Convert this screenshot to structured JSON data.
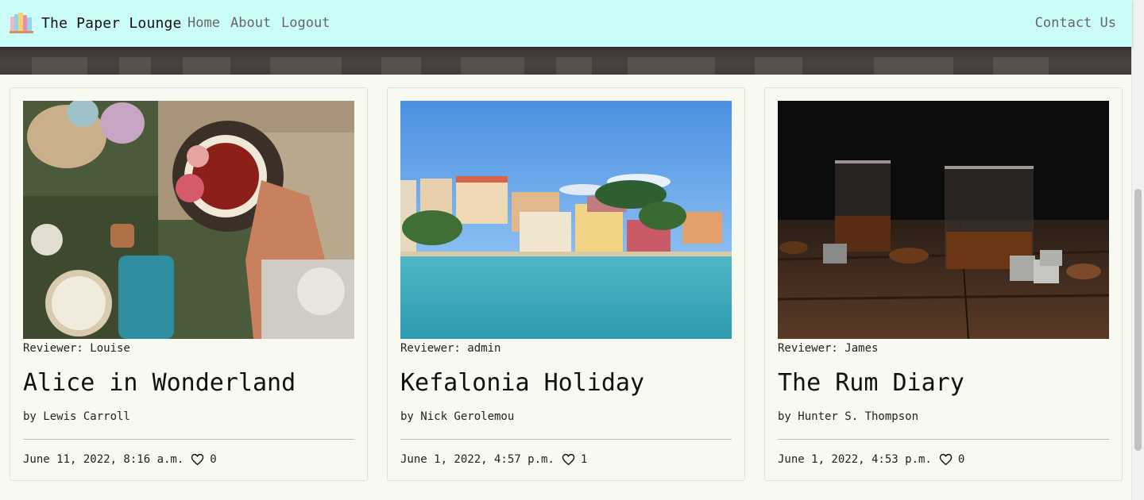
{
  "nav": {
    "brand": "The Paper Lounge",
    "brand_icon": "books-icon",
    "home": "Home",
    "about": "About",
    "logout": "Logout",
    "contact": "Contact Us"
  },
  "colors": {
    "navbar_bg": "#cbfdf9",
    "page_bg": "#f8f9f1"
  },
  "cards": [
    {
      "reviewer": "Reviewer: Louise",
      "title": "Alice in Wonderland",
      "author": "by Lewis Carroll",
      "date": "June 11, 2022, 8:16 a.m.",
      "likes": "0",
      "image": "tea-and-alice-book-photo"
    },
    {
      "reviewer": "Reviewer: admin",
      "title": "Kefalonia Holiday",
      "author": "by Nick Gerolemou",
      "date": "June 1, 2022, 4:57 p.m.",
      "likes": "1",
      "image": "seaside-village-photo"
    },
    {
      "reviewer": "Reviewer: James",
      "title": "The Rum Diary",
      "author": "by Hunter S. Thompson",
      "date": "June 1, 2022, 4:53 p.m.",
      "likes": "0",
      "image": "rum-glasses-photo"
    }
  ]
}
